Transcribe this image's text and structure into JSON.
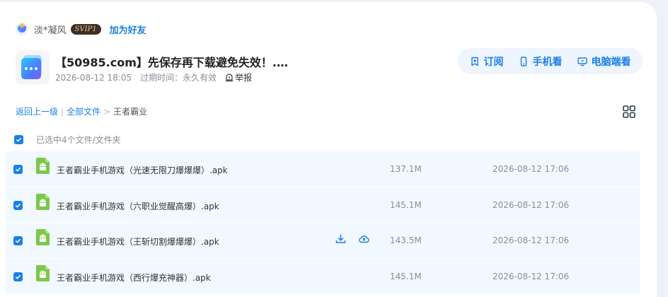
{
  "user": {
    "name": "淡*凝风",
    "vip_label": "SVIP1",
    "add_friend_label": "加为好友"
  },
  "share": {
    "title": "【50985.com】先保存再下载避免失效！.…",
    "created": "2026-08-12 18:05",
    "expire_label": "过期时间：",
    "expire_value": "永久有效",
    "report_label": "举报"
  },
  "actions": {
    "subscribe": "订阅",
    "mobile": "手机看",
    "desktop": "电脑端看"
  },
  "breadcrumb": {
    "back": "返回上一级",
    "all_files": "全部文件",
    "separator": ">",
    "current": "王者霸业"
  },
  "selection": {
    "summary": "已选中4个文件/文件夹"
  },
  "files": [
    {
      "name": "王者霸业手机游戏（光速无限刀爆爆爆）.apk",
      "size": "137.1M",
      "date": "2026-08-12 17:06",
      "checked": true
    },
    {
      "name": "王者霸业手机游戏（六职业觉醒高爆）.apk",
      "size": "145.1M",
      "date": "2026-08-12 17:06",
      "checked": true
    },
    {
      "name": "王者霸业手机游戏（王斩切割爆爆爆）.apk",
      "size": "143.5M",
      "date": "2026-08-12 17:06",
      "checked": true
    },
    {
      "name": "王者霸业手机游戏（西行爆充神器）.apk",
      "size": "145.1M",
      "date": "2026-08-12 17:06",
      "checked": true
    }
  ],
  "colors": {
    "accent": "#1b7fe6",
    "row_bg": "#f2f8ff",
    "apk_green": "#7cc84a",
    "vip_bg": "#3d2f27",
    "vip_text": "#f2c487"
  },
  "icons": {
    "subscribe": "bookmark-plus-icon",
    "mobile": "phone-icon",
    "desktop": "monitor-icon",
    "report": "alert-shield-icon",
    "grid": "grid-view-icon",
    "download": "download-icon",
    "cloud_save": "cloud-save-icon",
    "file": "android-apk-icon"
  }
}
